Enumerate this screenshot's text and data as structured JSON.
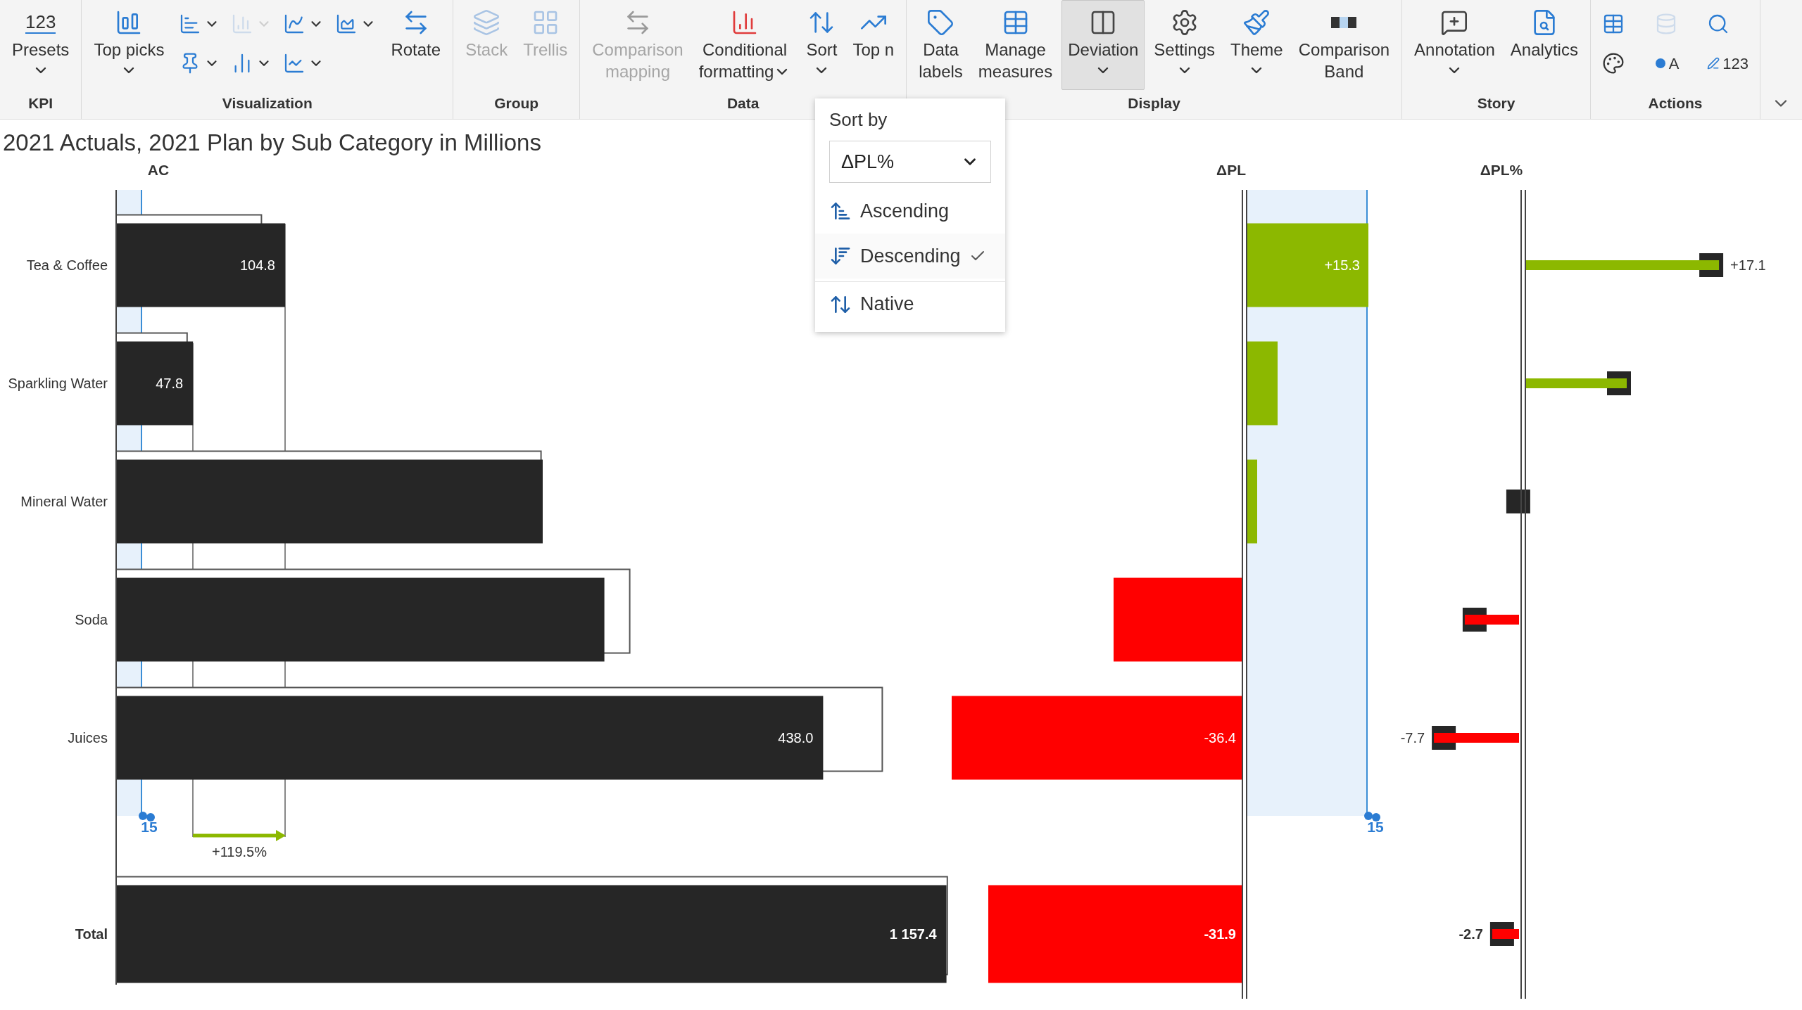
{
  "ribbon": [
    {
      "label": "KPI",
      "items": [
        {
          "kind": "large",
          "lines": [
            "Presets"
          ],
          "icon_text": "123",
          "caret": true,
          "disabled": false,
          "selected": false
        }
      ]
    },
    {
      "label": "Visualization",
      "items": [
        {
          "kind": "large",
          "lines": [
            "Top picks"
          ],
          "caret": true,
          "disabled": false,
          "selected": false
        },
        {
          "kind": "grid",
          "cells": [
            {
              "caret": true,
              "disabled": false
            },
            {
              "caret": true,
              "disabled": true
            },
            {
              "caret": true,
              "disabled": false
            },
            {
              "caret": true,
              "disabled": false
            },
            {
              "caret": true,
              "disabled": false
            },
            {
              "caret": true,
              "disabled": false
            },
            {
              "caret": true,
              "disabled": false
            }
          ]
        },
        {
          "kind": "large",
          "lines": [
            "Rotate"
          ],
          "caret": false,
          "disabled": false,
          "selected": false
        }
      ]
    },
    {
      "label": "Group",
      "items": [
        {
          "kind": "large",
          "lines": [
            "Stack"
          ],
          "caret": false,
          "disabled": true,
          "selected": false
        },
        {
          "kind": "large",
          "lines": [
            "Trellis"
          ],
          "caret": false,
          "disabled": true,
          "selected": false
        }
      ]
    },
    {
      "label": "Data",
      "items": [
        {
          "kind": "large",
          "lines": [
            "Comparison",
            "mapping"
          ],
          "caret": false,
          "disabled": true,
          "selected": false
        },
        {
          "kind": "large",
          "lines": [
            "Conditional",
            "formatting"
          ],
          "caret": true,
          "disabled": false,
          "selected": false
        },
        {
          "kind": "large",
          "lines": [
            "Sort"
          ],
          "caret": true,
          "disabled": false,
          "selected": false
        },
        {
          "kind": "large",
          "lines": [
            "Top n"
          ],
          "caret": false,
          "disabled": false,
          "selected": false
        }
      ]
    },
    {
      "label": "Display",
      "items": [
        {
          "kind": "large",
          "lines": [
            "Data",
            "labels"
          ],
          "caret": false,
          "disabled": false,
          "selected": false
        },
        {
          "kind": "large",
          "lines": [
            "Manage",
            "measures"
          ],
          "caret": false,
          "disabled": false,
          "selected": false
        },
        {
          "kind": "large",
          "lines": [
            "Deviation"
          ],
          "caret": true,
          "disabled": false,
          "selected": true
        },
        {
          "kind": "large",
          "lines": [
            "Settings"
          ],
          "caret": true,
          "disabled": false,
          "selected": false
        },
        {
          "kind": "large",
          "lines": [
            "Theme"
          ],
          "caret": true,
          "disabled": false,
          "selected": false
        },
        {
          "kind": "large",
          "lines": [
            "Comparison",
            "Band"
          ],
          "caret": false,
          "disabled": false,
          "selected": false
        }
      ]
    },
    {
      "label": "Story",
      "items": [
        {
          "kind": "large",
          "lines": [
            "Annotation"
          ],
          "caret": true,
          "disabled": false,
          "selected": false
        },
        {
          "kind": "large",
          "lines": [
            "Analytics"
          ],
          "caret": false,
          "disabled": false,
          "selected": false
        }
      ]
    },
    {
      "label": "Actions",
      "items": [
        {
          "kind": "grid",
          "cells": [
            {
              "caret": false,
              "disabled": false
            },
            {
              "caret": false,
              "disabled": true
            },
            {
              "caret": false,
              "disabled": false
            },
            {
              "caret": false,
              "disabled": false
            },
            {
              "caret": false,
              "disabled": false,
              "text": "A"
            },
            {
              "caret": false,
              "disabled": false,
              "text": "123"
            }
          ]
        }
      ]
    }
  ],
  "title": "2021 Actuals, 2021 Plan by Sub Category in Millions",
  "columns": [
    "AC",
    "ΔPL",
    "ΔPL%"
  ],
  "rows": [
    {
      "name": "Tea & Coffee",
      "kind": "category",
      "ac": {
        "level": 0.2,
        "label": "104.8"
      },
      "plan": {
        "level": 0.172
      },
      "dpl": {
        "kind": "positive",
        "level": 0.346,
        "label": "+15.3"
      },
      "dplp": {
        "kind": "positive",
        "level": 0.937,
        "label": "+17.1"
      }
    },
    {
      "name": "Sparkling Water",
      "kind": "category",
      "ac": {
        "level": 0.091,
        "label": "47.8"
      },
      "plan": {
        "level": 0.084
      },
      "dpl": {
        "kind": "positive",
        "level": 0.088
      },
      "dplp": {
        "kind": "positive",
        "level": 0.5
      }
    },
    {
      "name": "Mineral Water",
      "kind": "category",
      "ac": {
        "level": 0.505
      },
      "plan": {
        "level": 0.503
      },
      "dpl": {
        "kind": "positive",
        "level": 0.03
      },
      "dplp": {
        "kind": "positive",
        "level": 0.023
      }
    },
    {
      "name": "Soda",
      "kind": "category",
      "ac": {
        "level": 0.578
      },
      "plan": {
        "level": 0.608
      },
      "dpl": {
        "kind": "negative",
        "level": 0.366
      },
      "dplp": {
        "kind": "negative",
        "level": 0.277
      }
    },
    {
      "name": "Juices",
      "kind": "category",
      "ac": {
        "level": 0.837,
        "label": "438.0"
      },
      "plan": {
        "level": 0.907
      },
      "dpl": {
        "kind": "negative",
        "level": 0.826,
        "label": "-36.4"
      },
      "dplp": {
        "kind": "negative",
        "level": 0.423,
        "label": "-7.7"
      }
    },
    {
      "name": "Total",
      "kind": "total",
      "ac": {
        "level": 0.983,
        "label": "1 157.4"
      },
      "plan": {
        "level": 0.984
      },
      "dpl": {
        "kind": "negative",
        "level": 0.722,
        "label": "-31.9"
      },
      "dplp": {
        "kind": "negative",
        "level": 0.147,
        "label": "-2.7"
      }
    }
  ],
  "band_labels": [
    "15",
    "15"
  ],
  "difference_label": "+119.5%",
  "sort_menu": {
    "title": "Sort by",
    "field": {
      "value": "ΔPL%"
    },
    "options": [
      {
        "label": "Ascending",
        "kind": "direction",
        "selected": false
      },
      {
        "label": "Descending",
        "kind": "direction",
        "selected": true
      },
      {
        "label": "Native",
        "kind": "native",
        "selected": false
      }
    ]
  }
}
